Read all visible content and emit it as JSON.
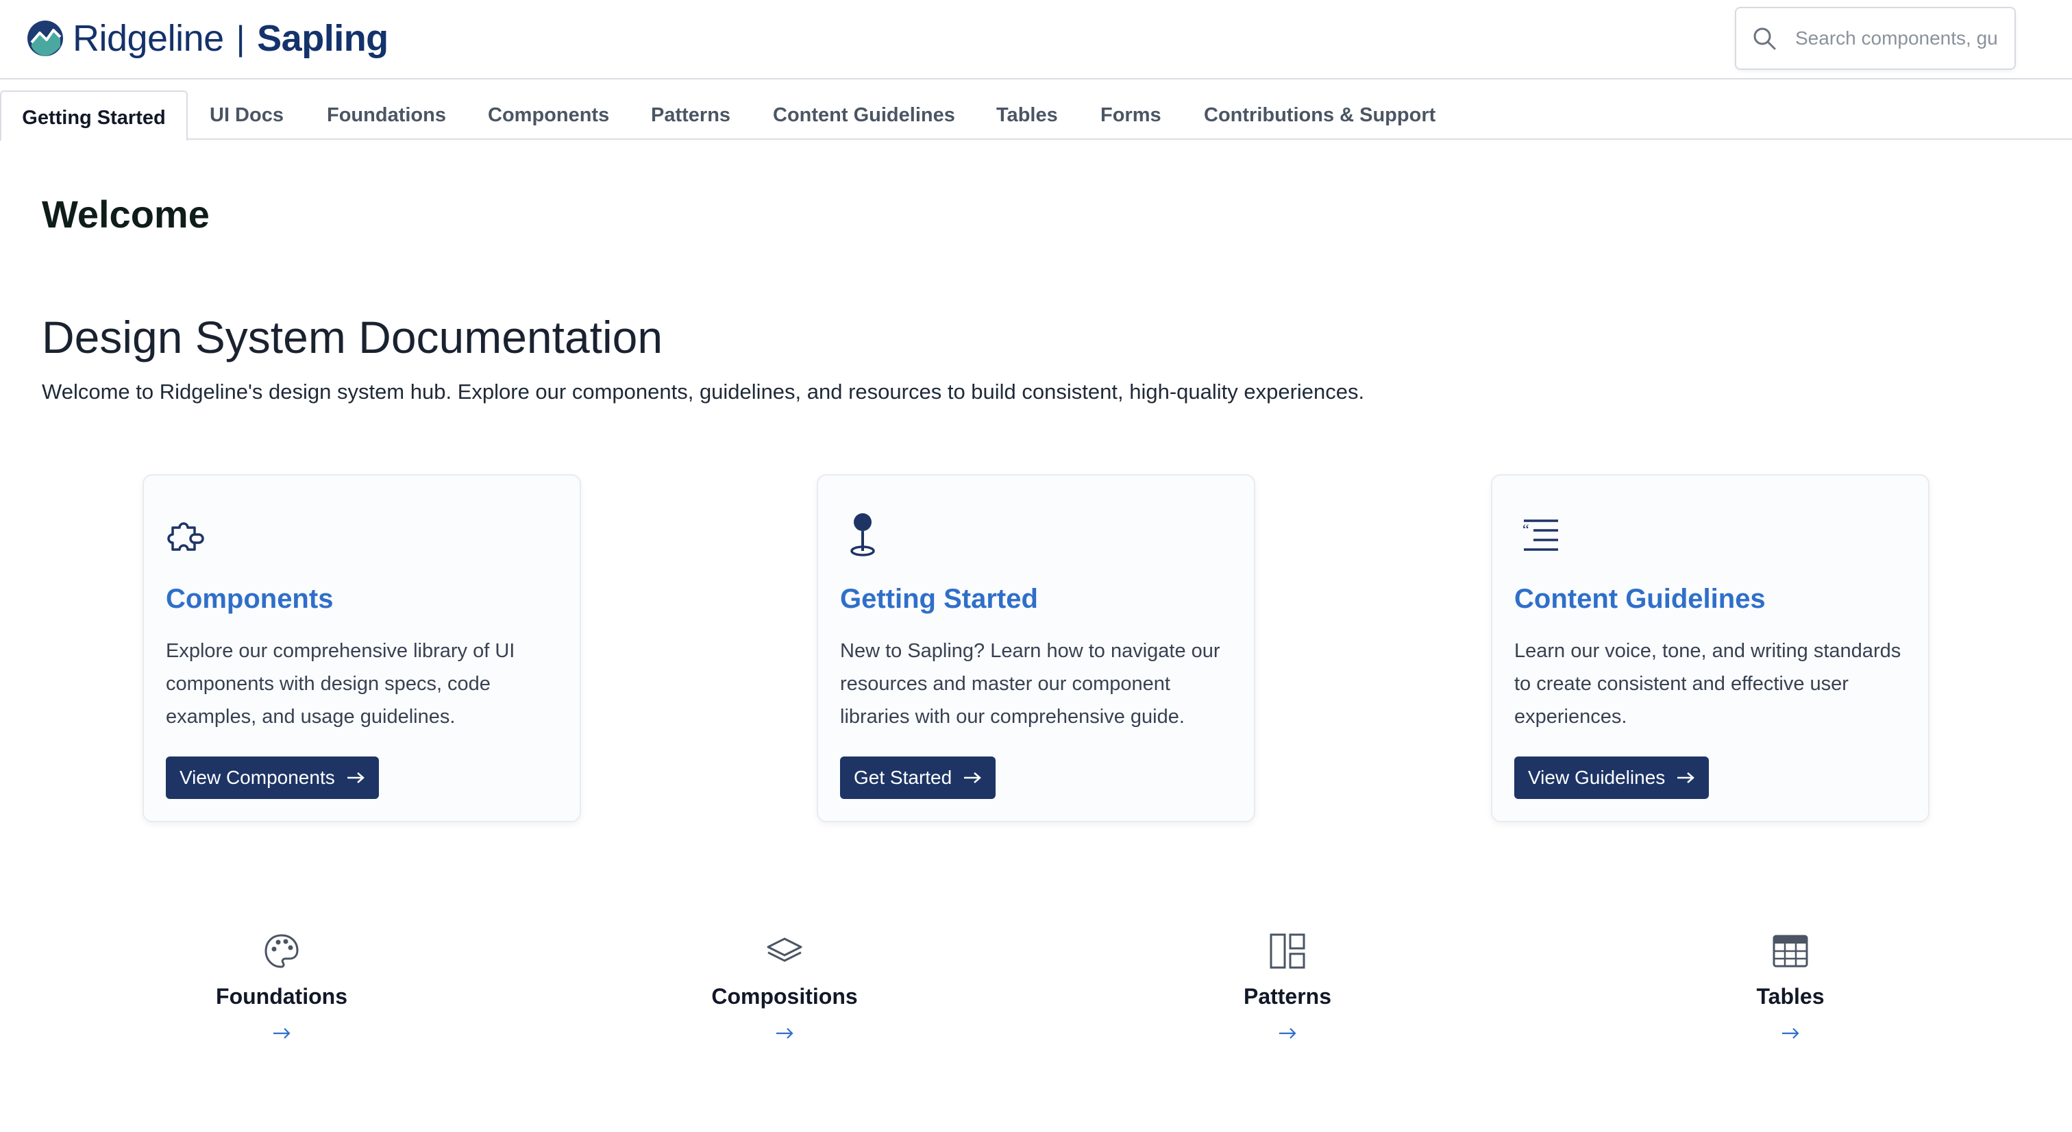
{
  "header": {
    "brand": "Ridgeline",
    "separator": "|",
    "product": "Sapling",
    "search_placeholder": "Search components, gu"
  },
  "tabs": [
    {
      "label": "Getting Started",
      "active": true
    },
    {
      "label": "UI Docs"
    },
    {
      "label": "Foundations"
    },
    {
      "label": "Components"
    },
    {
      "label": "Patterns"
    },
    {
      "label": "Content Guidelines"
    },
    {
      "label": "Tables"
    },
    {
      "label": "Forms"
    },
    {
      "label": "Contributions & Support"
    }
  ],
  "main": {
    "welcome": "Welcome",
    "title": "Design System Documentation",
    "intro": "Welcome to Ridgeline's design system hub. Explore our components, guidelines, and resources to build consistent, high-quality experiences."
  },
  "cards": [
    {
      "icon": "puzzle-icon",
      "title": "Components",
      "text": "Explore our comprehensive library of UI components with design specs, code examples, and usage guidelines.",
      "button": "View Components"
    },
    {
      "icon": "map-pin-icon",
      "title": "Getting Started",
      "text": "New to Sapling? Learn how to navigate our resources and master our component libraries with our comprehensive guide.",
      "button": "Get Started"
    },
    {
      "icon": "quote-lines-icon",
      "title": "Content Guidelines",
      "text": "Learn our voice, tone, and writing standards to create consistent and effective user experiences.",
      "button": "View Guidelines"
    }
  ],
  "quick_links": [
    {
      "icon": "palette-icon",
      "label": "Foundations"
    },
    {
      "icon": "layers-icon",
      "label": "Compositions"
    },
    {
      "icon": "layout-icon",
      "label": "Patterns"
    },
    {
      "icon": "table-icon",
      "label": "Tables"
    }
  ],
  "colors": {
    "brand_navy": "#14326b",
    "accent_blue": "#2f6fc9",
    "button_bg": "#1d3465",
    "logo_teal": "#4aa8a0"
  }
}
